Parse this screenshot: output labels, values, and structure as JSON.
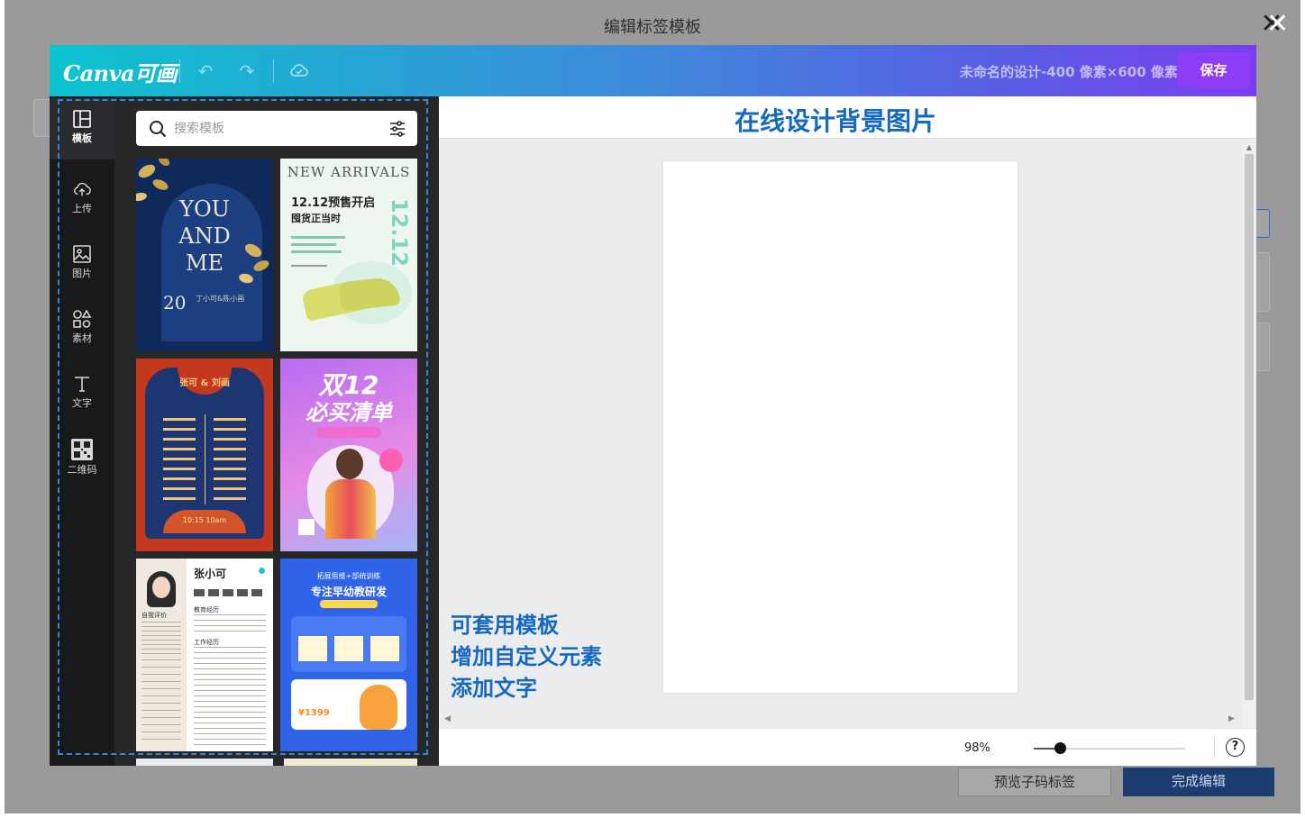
{
  "modal": {
    "title": "编辑标签模板",
    "close_icon": "close-icon"
  },
  "background_footer": {
    "preview_label": "预览子码标签",
    "finish_label": "完成编辑"
  },
  "topbar": {
    "logo": "Canva可画",
    "undo_icon": "undo-icon",
    "redo_icon": "redo-icon",
    "cloud_icon": "cloud-saved-icon",
    "design_name": "未命名的设计-400 像素×600 像素",
    "save_label": "保存"
  },
  "sidenav": {
    "items": [
      {
        "label": "模板",
        "icon": "template-icon",
        "active": true
      },
      {
        "label": "上传",
        "icon": "upload-icon"
      },
      {
        "label": "图片",
        "icon": "image-icon"
      },
      {
        "label": "素材",
        "icon": "elements-icon"
      },
      {
        "label": "文字",
        "icon": "text-icon"
      },
      {
        "label": "二维码",
        "icon": "qrcode-icon"
      }
    ]
  },
  "search": {
    "placeholder": "搜索模板",
    "icon": "search-icon",
    "filter_icon": "filter-icon"
  },
  "templates": [
    {
      "lines": [
        "YOU",
        "AND",
        "ME",
        "20",
        "丁小可&陈小画"
      ],
      "colors": {
        "bg": "#0f2a5a",
        "accent": "#d4b25c"
      }
    },
    {
      "lines": [
        "NEW ARRIVALS",
        "12.12预售开启",
        "囤货正当时",
        "12.12"
      ],
      "colors": {
        "bg": "#eef6f0",
        "accent": "#7fd6c0"
      }
    },
    {
      "lines": [
        "张可 & 刘画",
        "10:15 10am"
      ],
      "colors": {
        "bg": "#1d3570",
        "accent": "#c4381f"
      }
    },
    {
      "lines": [
        "双12",
        "必买清单"
      ],
      "colors": {
        "bg": "#c77df0",
        "accent": "#ff7ab8"
      }
    },
    {
      "lines": [
        "张小可",
        "教育经历",
        "工作经历",
        "自我评价"
      ],
      "colors": {
        "bg": "#ffffff",
        "accent": "#efe9e0"
      }
    },
    {
      "lines": [
        "拓展思维+部统训练",
        "专注早幼教研发",
        "¥1399"
      ],
      "colors": {
        "bg": "#2f63e8",
        "accent": "#ffd54a"
      }
    }
  ],
  "canvas": {
    "heading": "在线设计背景图片"
  },
  "annotations": [
    "可套用模板",
    "增加自定义元素",
    "添加文字"
  ],
  "zoom": {
    "percent": "98%",
    "level": 0.98,
    "help_icon": "help-icon"
  }
}
